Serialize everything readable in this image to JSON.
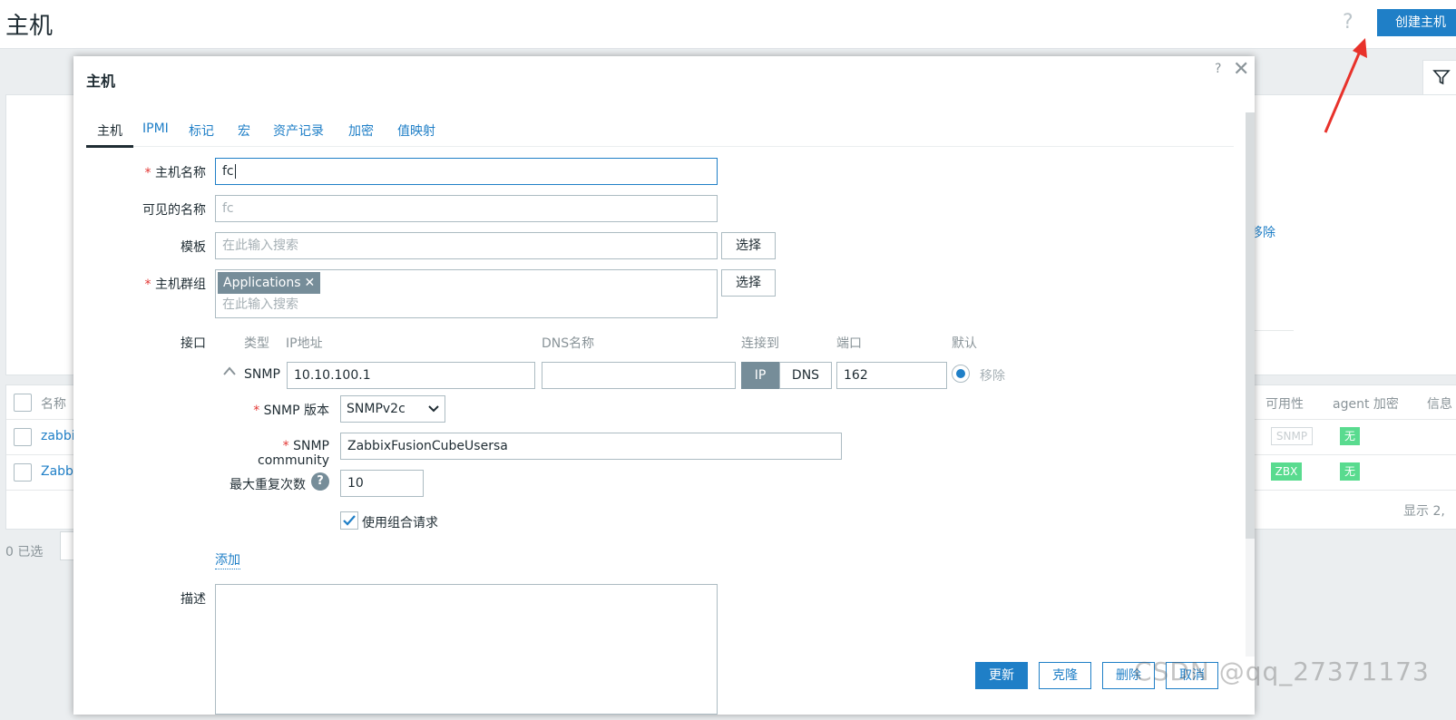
{
  "page": {
    "title": "主机",
    "help": "?",
    "create_button": "创建主机"
  },
  "background": {
    "remove_link": "移除",
    "table": {
      "col_name": "名称",
      "col_availability": "可用性",
      "col_agent_encryption": "agent 加密",
      "col_info": "信息",
      "rows": [
        {
          "name": "zabbi",
          "availability": "SNMP",
          "encryption": "无"
        },
        {
          "name": "Zabbi",
          "availability": "ZBX",
          "encryption": "无"
        }
      ],
      "footer": "显示 2,"
    },
    "selected_count": "0 已选"
  },
  "modal": {
    "title": "主机",
    "help": "?",
    "close": "✕",
    "tabs": [
      "主机",
      "IPMI",
      "标记",
      "宏",
      "资产记录",
      "加密",
      "值映射"
    ],
    "active_tab": "主机",
    "form": {
      "host_name_label": "主机名称",
      "host_name_value": "fc",
      "visible_name_label": "可见的名称",
      "visible_name_placeholder": "fc",
      "templates_label": "模板",
      "templates_placeholder": "在此输入搜索",
      "select_button": "选择",
      "host_groups_label": "主机群组",
      "host_groups_chip": "Applications",
      "host_groups_placeholder": "在此输入搜索",
      "interfaces_label": "接口",
      "if_cols": {
        "type": "类型",
        "ip": "IP地址",
        "dns": "DNS名称",
        "connect_to": "连接到",
        "port": "端口",
        "default": "默认"
      },
      "if_row": {
        "type": "SNMP",
        "ip": "10.10.100.1",
        "dns": "",
        "connect_ip": "IP",
        "connect_dns": "DNS",
        "port": "162",
        "remove": "移除"
      },
      "snmp_version_label": "SNMP 版本",
      "snmp_version_value": "SNMPv2c",
      "snmp_community_label": "SNMP community",
      "snmp_community_value": "ZabbixFusionCubeUsersa",
      "max_repetitions_label": "最大重复次数",
      "max_repetitions_value": "10",
      "bulk_label": "使用组合请求",
      "bulk_checked": true,
      "add_link": "添加",
      "description_label": "描述"
    },
    "buttons": {
      "update": "更新",
      "clone": "克隆",
      "delete": "删除",
      "cancel": "取消"
    }
  },
  "watermark": "CSDN @qq_27371173",
  "colors": {
    "accent": "#1f7fc7",
    "required": "#e33734",
    "chip": "#768d99",
    "status_green": "#59db8f",
    "annotation_arrow": "#e8322b"
  }
}
